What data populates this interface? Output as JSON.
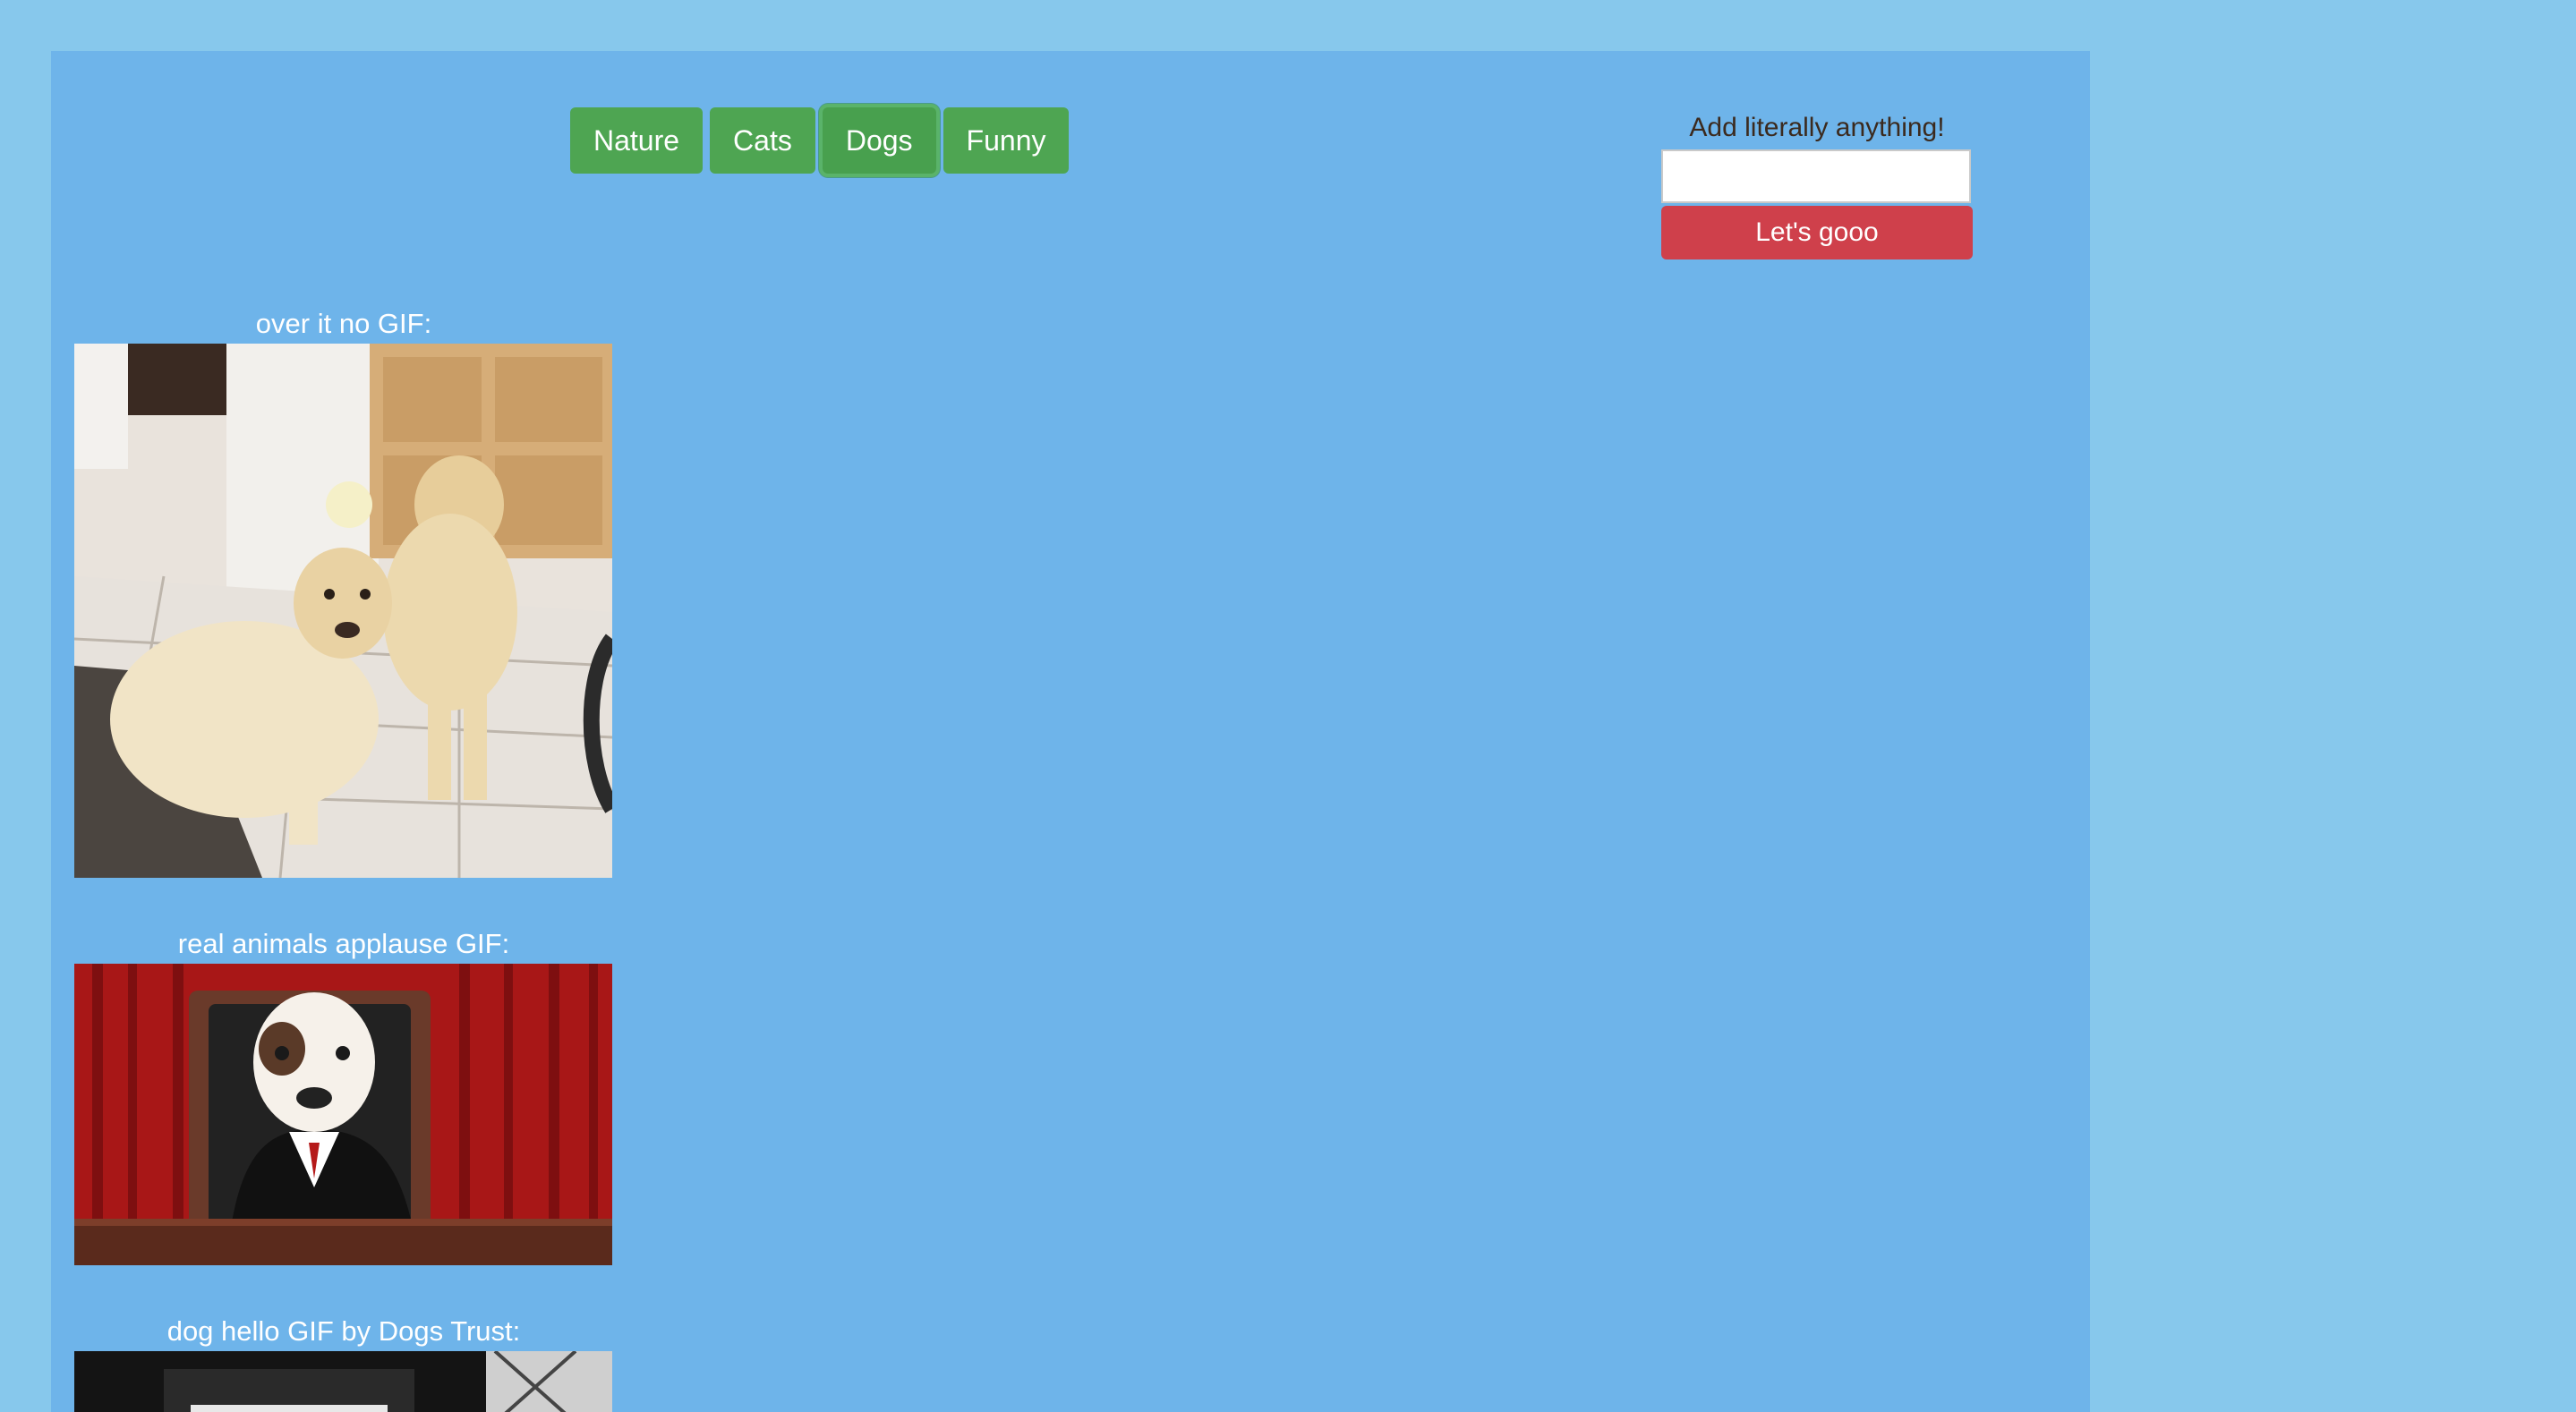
{
  "topics": [
    "Nature",
    "Cats",
    "Dogs",
    "Funny"
  ],
  "active_topic": "Dogs",
  "add_form": {
    "label": "Add literally anything!",
    "input_value": "",
    "input_placeholder": "",
    "submit_label": "Let's gooo"
  },
  "gifs": [
    {
      "title": "over it no GIF:"
    },
    {
      "title": "real animals applause GIF:"
    },
    {
      "title": "dog hello GIF by Dogs Trust:"
    }
  ],
  "colors": {
    "page_bg": "#87c8ec",
    "panel_bg": "#6eb4ea",
    "topic_button": "#4ea552",
    "submit_button": "#cf404b"
  }
}
